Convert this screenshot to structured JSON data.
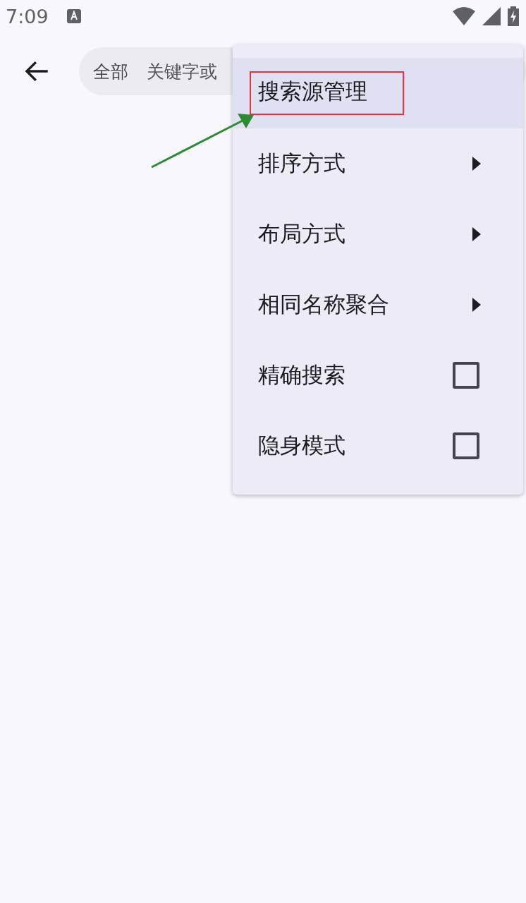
{
  "status_bar": {
    "time": "7:09"
  },
  "toolbar": {
    "filter": "全部",
    "search": {
      "placeholder": "关键字或"
    }
  },
  "menu": {
    "items": [
      {
        "kind": "action",
        "label": "搜索源管理",
        "selected": true,
        "outlined": true
      },
      {
        "kind": "submenu",
        "label": "排序方式",
        "selected": false
      },
      {
        "kind": "submenu",
        "label": "布局方式",
        "selected": false
      },
      {
        "kind": "submenu",
        "label": "相同名称聚合",
        "selected": false
      },
      {
        "kind": "checkbox",
        "label": "精确搜索",
        "selected": false,
        "checked": false
      },
      {
        "kind": "checkbox",
        "label": "隐身模式",
        "selected": false,
        "checked": false
      }
    ]
  },
  "annotations": [
    {
      "kind": "arrow"
    }
  ]
}
